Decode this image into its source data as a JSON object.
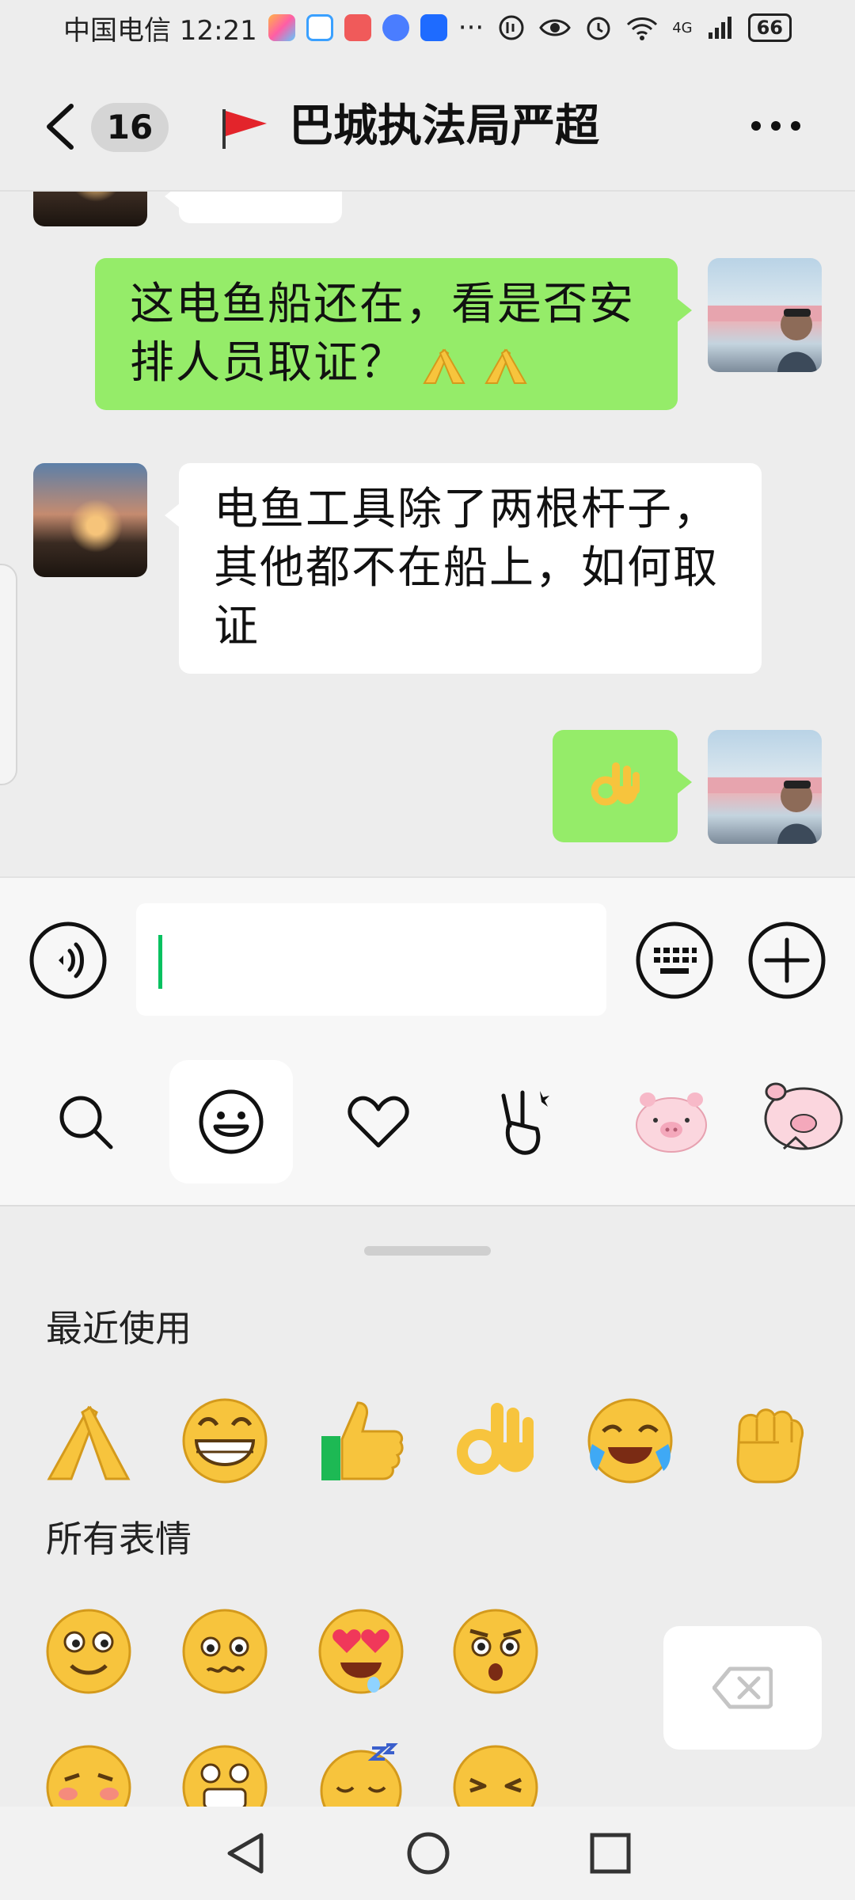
{
  "status_bar": {
    "carrier_time": "中国电信 12:21",
    "more": "···",
    "signal": "4G",
    "battery": "66"
  },
  "header": {
    "unread_count": "16",
    "title": "巴城执法局严超"
  },
  "messages": [
    {
      "side": "right",
      "text": "这电鱼船还在，看是否安排人员取证？"
    },
    {
      "side": "left",
      "text": "电鱼工具除了两根杆子，其他都不在船上，如何取证"
    },
    {
      "side": "right",
      "text": "OK hand emoji"
    }
  ],
  "composer": {
    "value": ""
  },
  "emoji_tabs": [
    "search-icon",
    "smiley-icon",
    "heart-icon",
    "victory-hand-icon",
    "pig-sticker-icon",
    "pig-wave-sticker-icon"
  ],
  "emoji_panel": {
    "recent_title": "最近使用",
    "all_title": "所有表情",
    "recent": [
      "palms-together",
      "grin",
      "thumbs-up",
      "ok-hand",
      "rolling-laugh",
      "fist"
    ],
    "all": [
      "smile",
      "awkward",
      "heart-eyes",
      "shocked",
      "shy",
      "grimace",
      "sleepy",
      "crying"
    ]
  },
  "colors": {
    "green_bubble": "#95ec69",
    "caret": "#07c160",
    "emoji_yellow": "#f7c43d"
  }
}
